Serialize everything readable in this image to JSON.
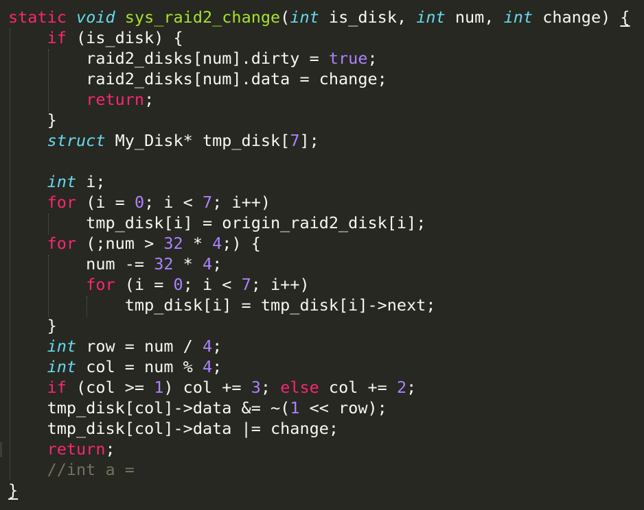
{
  "editor": {
    "language": "c",
    "theme": "monokai-like",
    "colors": {
      "background": "#272822",
      "keyword": "#f92672",
      "type": "#66d9ef",
      "function": "#a6e22e",
      "number": "#ae81ff",
      "text": "#f8f8f2",
      "comment": "#75715e"
    },
    "lines": [
      [
        {
          "t": "static",
          "c": "kw"
        },
        {
          "t": " ",
          "c": "plain"
        },
        {
          "t": "void",
          "c": "type"
        },
        {
          "t": " ",
          "c": "plain"
        },
        {
          "t": "sys_raid2_change",
          "c": "fn"
        },
        {
          "t": "(",
          "c": "plain"
        },
        {
          "t": "int",
          "c": "type"
        },
        {
          "t": " is_disk, ",
          "c": "plain"
        },
        {
          "t": "int",
          "c": "type"
        },
        {
          "t": " num, ",
          "c": "plain"
        },
        {
          "t": "int",
          "c": "type"
        },
        {
          "t": " change) ",
          "c": "plain"
        },
        {
          "t": "{",
          "c": "plain",
          "m": true
        }
      ],
      [
        {
          "t": "    ",
          "c": "plain"
        },
        {
          "t": "if",
          "c": "kw"
        },
        {
          "t": " (is_disk) {",
          "c": "plain"
        }
      ],
      [
        {
          "t": "        raid2_disks[num].dirty = ",
          "c": "plain"
        },
        {
          "t": "true",
          "c": "num"
        },
        {
          "t": ";",
          "c": "plain"
        }
      ],
      [
        {
          "t": "        raid2_disks[num].data = change;",
          "c": "plain"
        }
      ],
      [
        {
          "t": "        ",
          "c": "plain"
        },
        {
          "t": "return",
          "c": "kw"
        },
        {
          "t": ";",
          "c": "plain"
        }
      ],
      [
        {
          "t": "    }",
          "c": "plain"
        }
      ],
      [
        {
          "t": "    ",
          "c": "plain"
        },
        {
          "t": "struct",
          "c": "type"
        },
        {
          "t": " My_Disk* tmp_disk[",
          "c": "plain"
        },
        {
          "t": "7",
          "c": "num"
        },
        {
          "t": "];",
          "c": "plain"
        }
      ],
      [],
      [
        {
          "t": "    ",
          "c": "plain"
        },
        {
          "t": "int",
          "c": "type"
        },
        {
          "t": " i;",
          "c": "plain"
        }
      ],
      [
        {
          "t": "    ",
          "c": "plain"
        },
        {
          "t": "for",
          "c": "kw"
        },
        {
          "t": " (i = ",
          "c": "plain"
        },
        {
          "t": "0",
          "c": "num"
        },
        {
          "t": "; i < ",
          "c": "plain"
        },
        {
          "t": "7",
          "c": "num"
        },
        {
          "t": "; i++)",
          "c": "plain"
        }
      ],
      [
        {
          "t": "        tmp_disk[i] = origin_raid2_disk[i];",
          "c": "plain"
        }
      ],
      [
        {
          "t": "    ",
          "c": "plain"
        },
        {
          "t": "for",
          "c": "kw"
        },
        {
          "t": " (;num > ",
          "c": "plain"
        },
        {
          "t": "32",
          "c": "num"
        },
        {
          "t": " * ",
          "c": "plain"
        },
        {
          "t": "4",
          "c": "num"
        },
        {
          "t": ";) {",
          "c": "plain"
        }
      ],
      [
        {
          "t": "        num -= ",
          "c": "plain"
        },
        {
          "t": "32",
          "c": "num"
        },
        {
          "t": " * ",
          "c": "plain"
        },
        {
          "t": "4",
          "c": "num"
        },
        {
          "t": ";",
          "c": "plain"
        }
      ],
      [
        {
          "t": "        ",
          "c": "plain"
        },
        {
          "t": "for",
          "c": "kw"
        },
        {
          "t": " (i = ",
          "c": "plain"
        },
        {
          "t": "0",
          "c": "num"
        },
        {
          "t": "; i < ",
          "c": "plain"
        },
        {
          "t": "7",
          "c": "num"
        },
        {
          "t": "; i++)",
          "c": "plain"
        }
      ],
      [
        {
          "t": "            tmp_disk[i] = tmp_disk[i]->next;",
          "c": "plain"
        }
      ],
      [
        {
          "t": "    }",
          "c": "plain"
        }
      ],
      [
        {
          "t": "    ",
          "c": "plain"
        },
        {
          "t": "int",
          "c": "type"
        },
        {
          "t": " row = num / ",
          "c": "plain"
        },
        {
          "t": "4",
          "c": "num"
        },
        {
          "t": ";",
          "c": "plain"
        }
      ],
      [
        {
          "t": "    ",
          "c": "plain"
        },
        {
          "t": "int",
          "c": "type"
        },
        {
          "t": " col = num % ",
          "c": "plain"
        },
        {
          "t": "4",
          "c": "num"
        },
        {
          "t": ";",
          "c": "plain"
        }
      ],
      [
        {
          "t": "    ",
          "c": "plain"
        },
        {
          "t": "if",
          "c": "kw"
        },
        {
          "t": " (col >= ",
          "c": "plain"
        },
        {
          "t": "1",
          "c": "num"
        },
        {
          "t": ") col += ",
          "c": "plain"
        },
        {
          "t": "3",
          "c": "num"
        },
        {
          "t": "; ",
          "c": "plain"
        },
        {
          "t": "else",
          "c": "kw"
        },
        {
          "t": " col += ",
          "c": "plain"
        },
        {
          "t": "2",
          "c": "num"
        },
        {
          "t": ";",
          "c": "plain"
        }
      ],
      [
        {
          "t": "    tmp_disk[col]->data &= ~(",
          "c": "plain"
        },
        {
          "t": "1",
          "c": "num"
        },
        {
          "t": " << row);",
          "c": "plain"
        }
      ],
      [
        {
          "t": "    tmp_disk[col]->data |= change;",
          "c": "plain"
        }
      ],
      [
        {
          "t": "    ",
          "c": "plain"
        },
        {
          "t": "return",
          "c": "kw"
        },
        {
          "t": ";",
          "c": "plain"
        }
      ],
      [
        {
          "t": "    ",
          "c": "plain"
        },
        {
          "t": "//int a =",
          "c": "comment"
        }
      ],
      [
        {
          "t": "}",
          "c": "plain",
          "m": true
        }
      ]
    ]
  }
}
